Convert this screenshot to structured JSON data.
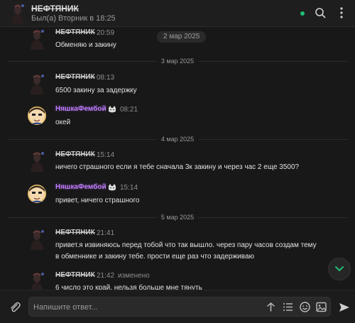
{
  "header": {
    "title": "НЕФТЯНИК",
    "status": "Был(а) Вторник в 18:25"
  },
  "date_pill": "2 мар 2025",
  "dividers": [
    "3 мар 2025",
    "4 мар 2025",
    "5 мар 2025"
  ],
  "messages": [
    {
      "name": "НЕФТЯНИК",
      "time": "20:59",
      "text": "Обменяю и закину"
    },
    {
      "name": "НЕФТЯНИК",
      "time": "08:13",
      "text": "6500 закину за задержку"
    },
    {
      "name": "НяшкаФембой",
      "time": "08:21",
      "text": "окей"
    },
    {
      "name": "НЕФТЯНИК",
      "time": "15:14",
      "text": "ничего страшного если я тебе сначала 3к закину и через час 2 еще 3500?"
    },
    {
      "name": "НяшкаФембой",
      "time": "15:14",
      "text": "привет, ничего страшного"
    },
    {
      "name": "НЕФТЯНИК",
      "time": "21:41",
      "text_lines": [
        "привет.я извиняюсь перед тобой что так вышло. через пару часов создам тему",
        "в обменнике и закину тебе. прости еще раз что задерживаю"
      ]
    },
    {
      "name": "НЕФТЯНИК",
      "time": "21:42",
      "edited": "изменено",
      "text": "6 число это край, нельзя больше мне тянуть"
    }
  ],
  "composer": {
    "placeholder": "Напишите ответ..."
  },
  "colors": {
    "background": "#181818",
    "accent_online": "#1fbf73",
    "accent_scroll": "#1fbf73",
    "purple_name": "#c07cff"
  },
  "icons": [
    "avatar",
    "search-icon",
    "more-icon",
    "chevron-down-icon",
    "paperclip-icon",
    "format-icon",
    "list-icon",
    "emoji-icon",
    "image-icon",
    "send-icon",
    "cat-badge-icon"
  ]
}
